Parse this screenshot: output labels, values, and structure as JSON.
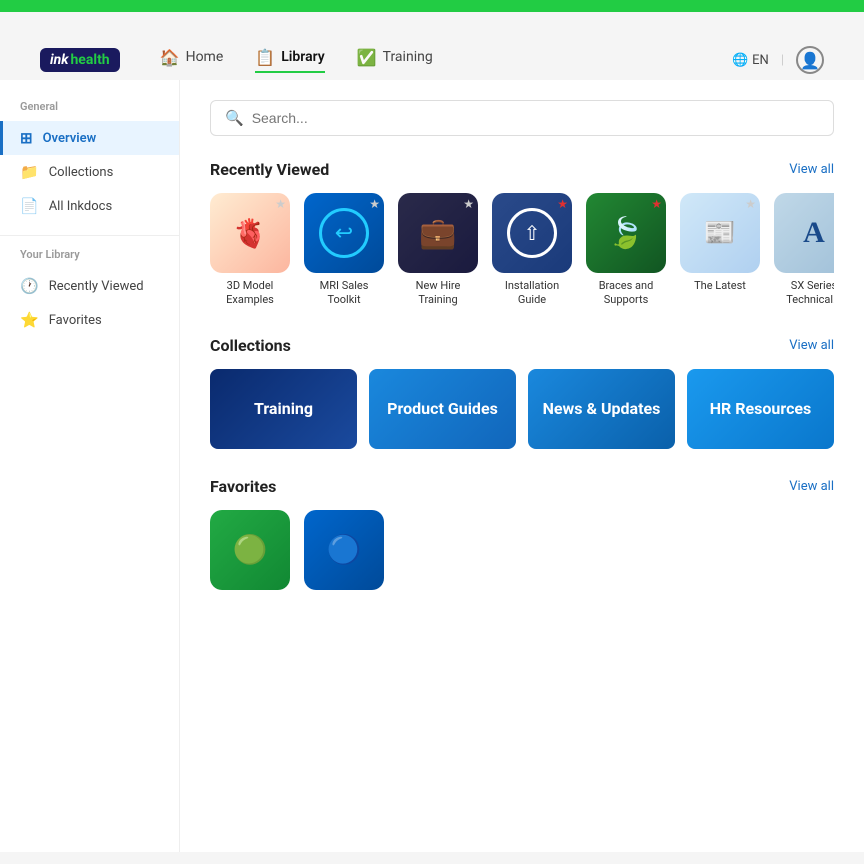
{
  "topBar": {
    "greenBarHeight": 12
  },
  "navbar": {
    "logo": {
      "ink": "ink",
      "health": "health"
    },
    "links": [
      {
        "id": "home",
        "label": "Home",
        "icon": "🏠",
        "active": false
      },
      {
        "id": "library",
        "label": "Library",
        "icon": "📋",
        "active": true
      },
      {
        "id": "training",
        "label": "Training",
        "icon": "✅",
        "active": false
      }
    ],
    "lang": "EN",
    "userIcon": "👤"
  },
  "sidebar": {
    "generalLabel": "General",
    "items": [
      {
        "id": "overview",
        "label": "Overview",
        "icon": "⊞",
        "active": true
      },
      {
        "id": "collections",
        "label": "Collections",
        "icon": "📁",
        "active": false
      },
      {
        "id": "all-inkdocs",
        "label": "All Inkdocs",
        "icon": "📄",
        "active": false
      }
    ],
    "yourLibraryLabel": "Your Library",
    "libraryItems": [
      {
        "id": "recently-viewed",
        "label": "Recently Viewed",
        "icon": "🕐",
        "active": false
      },
      {
        "id": "favorites",
        "label": "Favorites",
        "icon": "⭐",
        "active": false
      }
    ]
  },
  "search": {
    "placeholder": "Search..."
  },
  "recentlyViewed": {
    "title": "Recently Viewed",
    "viewAll": "View all",
    "items": [
      {
        "id": "3d-model",
        "label": "3D Model Examples",
        "type": "heart",
        "starred": false
      },
      {
        "id": "mri-sales",
        "label": "MRI Sales Toolkit",
        "type": "mri",
        "starred": false
      },
      {
        "id": "new-hire",
        "label": "New Hire Training",
        "type": "briefcase",
        "starred": false
      },
      {
        "id": "installation",
        "label": "Installation Guide",
        "type": "share",
        "starred": true,
        "starColor": "red"
      },
      {
        "id": "braces",
        "label": "Braces and Supports",
        "type": "braces",
        "starred": true,
        "starColor": "red"
      },
      {
        "id": "the-latest",
        "label": "The Latest",
        "type": "news",
        "starred": false
      },
      {
        "id": "sx-series",
        "label": "SX Series Technical...",
        "type": "sx",
        "starred": false
      }
    ]
  },
  "collections": {
    "title": "Collections",
    "viewAll": "View all",
    "items": [
      {
        "id": "training",
        "label": "Training",
        "type": "training"
      },
      {
        "id": "product-guides",
        "label": "Product Guides",
        "type": "product"
      },
      {
        "id": "news-updates",
        "label": "News & Updates",
        "type": "news"
      },
      {
        "id": "hr-resources",
        "label": "HR Resources",
        "type": "hr"
      }
    ]
  },
  "favorites": {
    "title": "Favorites",
    "viewAll": "View all",
    "items": [
      {
        "id": "fav-1",
        "type": "green"
      },
      {
        "id": "fav-2",
        "type": "blue"
      }
    ]
  }
}
